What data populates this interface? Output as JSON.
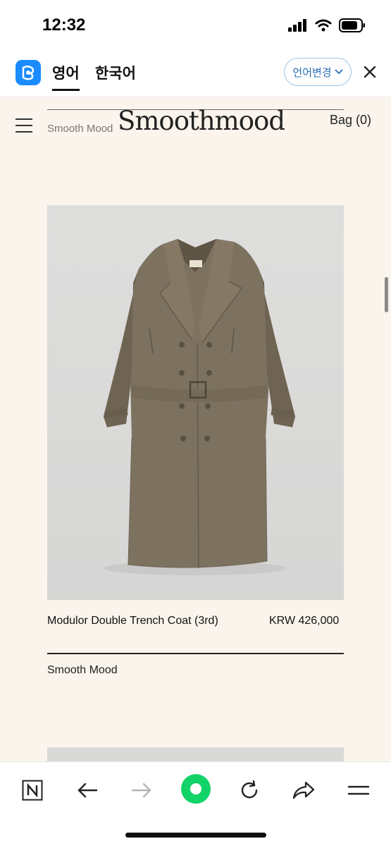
{
  "status": {
    "time": "12:32"
  },
  "translate": {
    "tabs": [
      {
        "label": "영어"
      },
      {
        "label": "한국어"
      }
    ],
    "language_button": "언어변경"
  },
  "site": {
    "brand_small": "Smooth Mood",
    "logo": "Smoothmood",
    "bag": "Bag (0)"
  },
  "product": {
    "name": "Modulor Double Trench Coat (3rd)",
    "price": "KRW 426,000",
    "brand": "Smooth Mood",
    "coat_color": "#7d715f"
  },
  "icons": [
    "signal-icon",
    "wifi-icon",
    "battery-icon",
    "papago-logo-icon",
    "chevron-down-icon",
    "close-icon",
    "menu-icon",
    "naver-n-icon",
    "back-arrow-icon",
    "forward-arrow-icon",
    "home-green-icon",
    "refresh-icon",
    "share-icon",
    "more-menu-icon"
  ]
}
